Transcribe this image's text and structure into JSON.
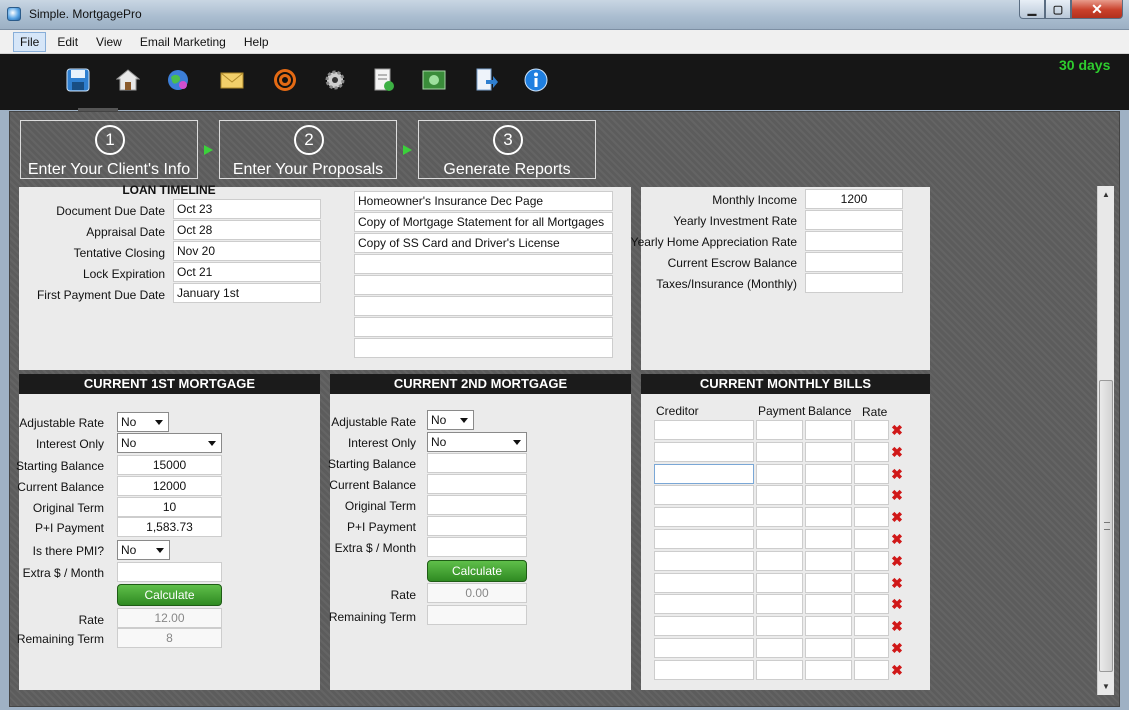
{
  "window": {
    "title": "Simple. MortgagePro",
    "close_glyph": "✕",
    "min_glyph": "▁",
    "max_glyph": "▢"
  },
  "menu": [
    "File",
    "Edit",
    "View",
    "Email Marketing",
    "Help"
  ],
  "toolbar": {
    "trial_label": "30 days",
    "icons": [
      "save-icon",
      "house-icon",
      "globe-icon",
      "mail-icon",
      "target-icon",
      "settings-gear-icon",
      "document-icon",
      "money-icon",
      "export-icon",
      "info-icon"
    ]
  },
  "steps": [
    {
      "number": "1",
      "label": "Enter Your Client's Info"
    },
    {
      "number": "2",
      "label": "Enter Your Proposals"
    },
    {
      "number": "3",
      "label": "Generate Reports"
    }
  ],
  "loan_timeline": {
    "title": "LOAN TIMELINE",
    "rows": [
      {
        "label": "Document Due Date",
        "value": "Oct 23"
      },
      {
        "label": "Appraisal Date",
        "value": "Oct 28"
      },
      {
        "label": "Tentative Closing",
        "value": "Nov 20"
      },
      {
        "label": "Lock Expiration",
        "value": "Oct 21"
      },
      {
        "label": "First Payment Due Date",
        "value": "January 1st"
      }
    ]
  },
  "documents": [
    "Homeowner's Insurance Dec Page",
    "Copy of Mortgage Statement for all Mortgages",
    "Copy of SS Card and Driver's License",
    "",
    "",
    "",
    "",
    ""
  ],
  "income": {
    "rows": [
      {
        "label": "Monthly Income",
        "value": "1200"
      },
      {
        "label": "Yearly Investment Rate",
        "value": ""
      },
      {
        "label": "Yearly Home Appreciation Rate",
        "value": ""
      },
      {
        "label": "Current Escrow Balance",
        "value": ""
      },
      {
        "label": "Taxes/Insurance (Monthly)",
        "value": ""
      }
    ]
  },
  "first_mortgage": {
    "title": "CURRENT 1ST MORTGAGE",
    "adjustable_rate": {
      "label": "Adjustable Rate",
      "value": "No"
    },
    "interest_only": {
      "label": "Interest Only",
      "value": "No"
    },
    "starting_balance": {
      "label": "Starting Balance",
      "value": "15000"
    },
    "current_balance": {
      "label": "Current Balance",
      "value": "12000"
    },
    "original_term": {
      "label": "Original Term",
      "value": "10"
    },
    "pi_payment": {
      "label": "P+I Payment",
      "value": "1,583.73"
    },
    "pmi": {
      "label": "Is there PMI?",
      "value": "No"
    },
    "extra": {
      "label": "Extra $ / Month",
      "value": ""
    },
    "calculate_label": "Calculate",
    "rate": {
      "label": "Rate",
      "value": "12.00"
    },
    "remaining_term": {
      "label": "Remaining Term",
      "value": "8"
    }
  },
  "second_mortgage": {
    "title": "CURRENT 2ND MORTGAGE",
    "adjustable_rate": {
      "label": "Adjustable Rate",
      "value": "No"
    },
    "interest_only": {
      "label": "Interest Only",
      "value": "No"
    },
    "starting_balance": {
      "label": "Starting Balance",
      "value": ""
    },
    "current_balance": {
      "label": "Current Balance",
      "value": ""
    },
    "original_term": {
      "label": "Original Term",
      "value": ""
    },
    "pi_payment": {
      "label": "P+I Payment",
      "value": ""
    },
    "extra": {
      "label": "Extra $ / Month",
      "value": ""
    },
    "calculate_label": "Calculate",
    "rate": {
      "label": "Rate",
      "value": "0.00"
    },
    "remaining_term": {
      "label": "Remaining Term",
      "value": ""
    }
  },
  "monthly_bills": {
    "title": "CURRENT MONTHLY BILLS",
    "columns": [
      "Creditor",
      "Payment",
      "Balance",
      "Rate"
    ],
    "row_count": 12,
    "delete_glyph": "✖"
  }
}
